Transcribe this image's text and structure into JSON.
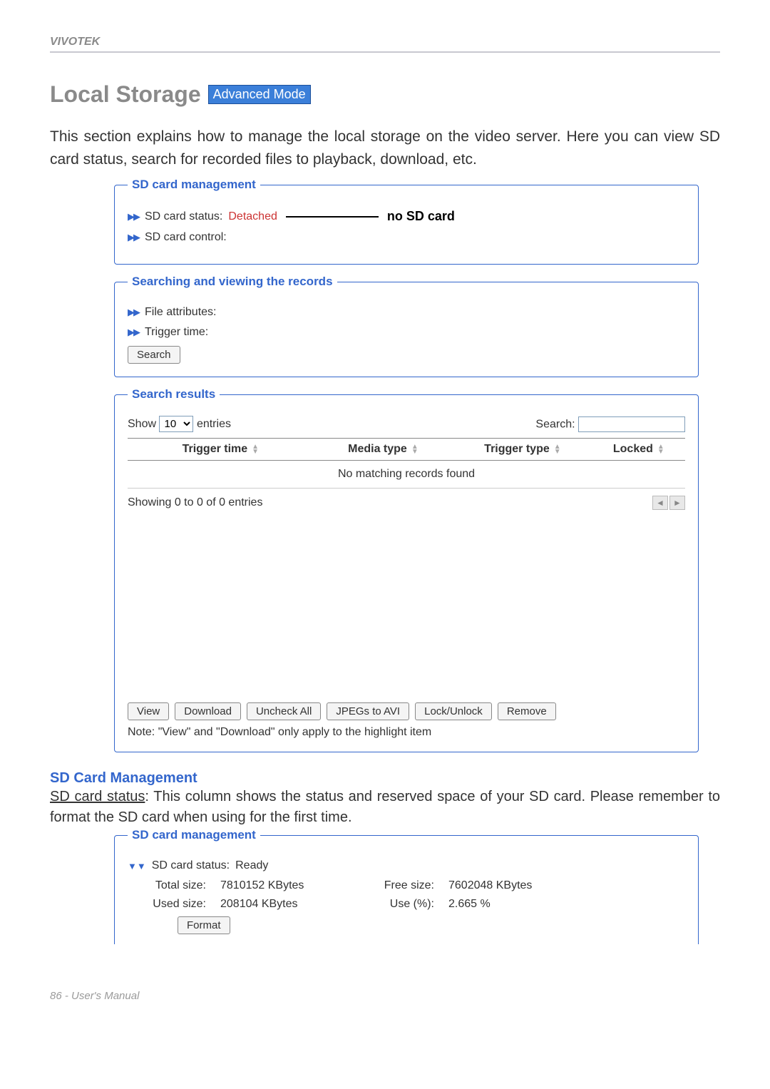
{
  "header": {
    "brand": "VIVOTEK"
  },
  "title": "Local Storage",
  "badge": "Advanced Mode",
  "intro": "This section explains how to manage the local storage on the video server. Here you can view SD card status, search for recorded files to playback, download, etc.",
  "panel1": {
    "legend": "SD card management",
    "status_label": "SD card status:",
    "status_value": "Detached",
    "annotation": "no SD card",
    "control_label": "SD card control:"
  },
  "panel2": {
    "legend": "Searching and viewing the records",
    "file_attr_label": "File attributes:",
    "trigger_time_label": "Trigger time:",
    "search_btn": "Search"
  },
  "panel3": {
    "legend": "Search results",
    "show_prefix": "Show",
    "show_value": "10",
    "show_suffix": "entries",
    "search_label": "Search:",
    "cols": {
      "c1": "Trigger time",
      "c2": "Media type",
      "c3": "Trigger type",
      "c4": "Locked"
    },
    "no_records": "No matching records found",
    "showing": "Showing 0 to 0 of 0 entries",
    "actions": {
      "view": "View",
      "download": "Download",
      "uncheck": "Uncheck All",
      "jpegs": "JPEGs to AVI",
      "lock": "Lock/Unlock",
      "remove": "Remove"
    },
    "note": "Note: \"View\" and \"Download\" only apply to the highlight item"
  },
  "subheading": "SD Card Management",
  "body": {
    "label_underlined": "SD card status",
    "text": ": This column shows the status and reserved space of your SD card. Please remember to format the SD card when using for the first time."
  },
  "panel4": {
    "legend": "SD card management",
    "status_label": "SD card status:",
    "status_value": "Ready",
    "total_label": "Total size:",
    "total_value": "7810152 KBytes",
    "free_label": "Free size:",
    "free_value": "7602048 KBytes",
    "used_label": "Used size:",
    "used_value": "208104 KBytes",
    "usepct_label": "Use (%):",
    "usepct_value": "2.665 %",
    "format_btn": "Format"
  },
  "footer": "86 - User's Manual"
}
